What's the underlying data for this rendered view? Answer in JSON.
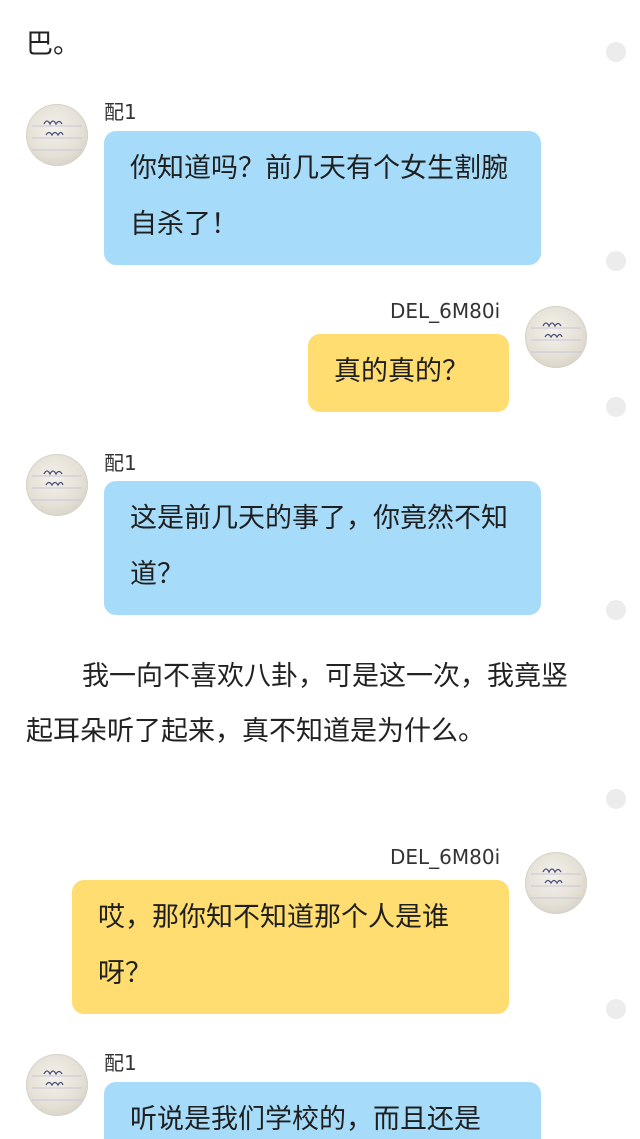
{
  "narration": [
    {
      "text": "巴。"
    },
    {
      "text": "我一向不喜欢八卦，可是这一次，我竟竖起耳朵听了起来，真不知道是为什么。"
    }
  ],
  "messages": [
    {
      "sender": "配1",
      "side": "left",
      "text": "你知道吗？前几天有个女生割腕自杀了！"
    },
    {
      "sender": "DEL_6M80i",
      "side": "right",
      "text": "真的真的？"
    },
    {
      "sender": "配1",
      "side": "left",
      "text": "这是前几天的事了，你竟然不知道？"
    },
    {
      "sender": "DEL_6M80i",
      "side": "right",
      "text": "哎，那你知不知道那个人是谁呀？"
    },
    {
      "sender": "配1",
      "side": "left",
      "text": "听说是我们学校的，而且还是"
    }
  ],
  "colors": {
    "left_bubble": "#a6dcfa",
    "right_bubble": "#ffdd70",
    "side_dot": "#ececec"
  },
  "icons": {
    "avatar": "handwritten-note-avatar",
    "side_marker": "comment-dot-icon"
  }
}
